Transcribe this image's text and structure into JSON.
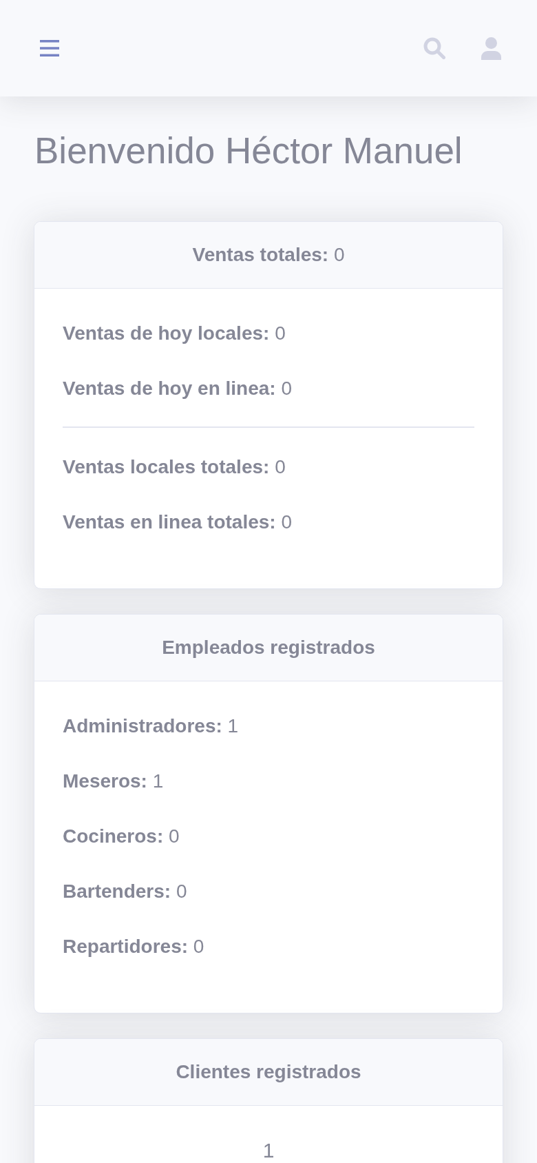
{
  "heading": "Bienvenido Héctor Manuel",
  "cards": [
    {
      "kind": "list",
      "title": "Ventas totales:",
      "title_value": "0",
      "groups": [
        [
          {
            "label": "Ventas de hoy locales:",
            "value": "0"
          },
          {
            "label": "Ventas de hoy en linea:",
            "value": "0"
          }
        ],
        [
          {
            "label": "Ventas locales totales:",
            "value": "0"
          },
          {
            "label": "Ventas en linea totales:",
            "value": "0"
          }
        ]
      ]
    },
    {
      "kind": "list",
      "title": "Empleados registrados",
      "groups": [
        [
          {
            "label": "Administradores:",
            "value": "1"
          },
          {
            "label": "Meseros:",
            "value": "1"
          },
          {
            "label": "Cocineros:",
            "value": "0"
          },
          {
            "label": "Bartenders:",
            "value": "0"
          },
          {
            "label": "Repartidores:",
            "value": "0"
          }
        ]
      ]
    },
    {
      "kind": "count",
      "title": "Clientes registrados",
      "count": "1"
    }
  ]
}
